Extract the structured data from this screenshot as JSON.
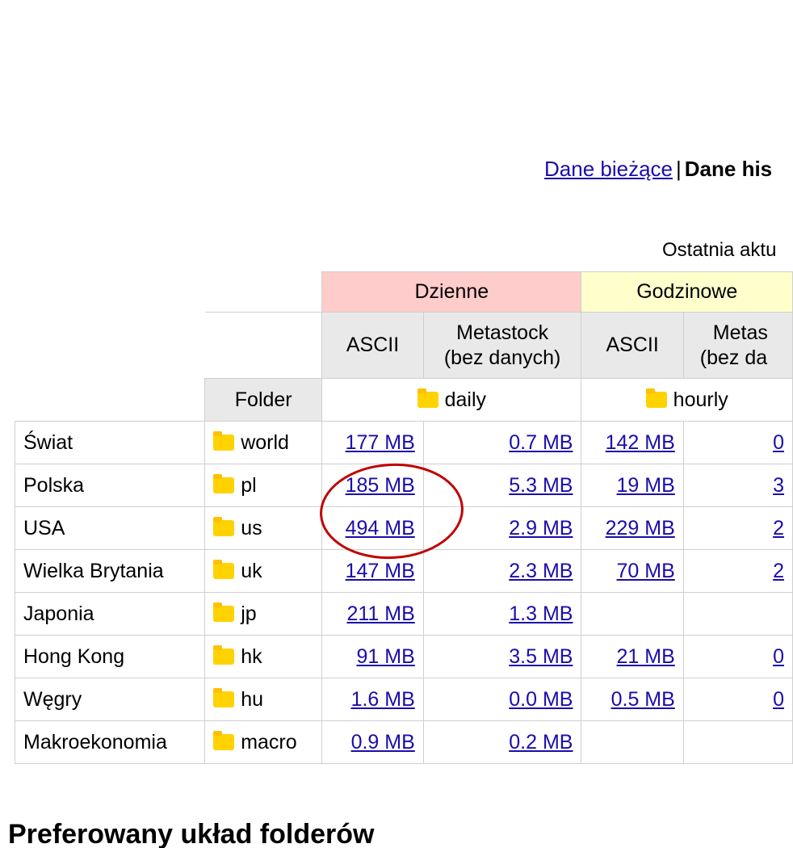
{
  "nav": {
    "current_link": "Dane bieżące",
    "separator": "|",
    "historical_label": "Dane his"
  },
  "updated_label": "Ostatnia aktu",
  "table": {
    "groups": [
      {
        "label": "Dzienne",
        "color": "#ffcccc"
      },
      {
        "label": "Godzinowe",
        "color": "#ffffcc"
      }
    ],
    "subheaders": {
      "ascii": "ASCII",
      "metastock_line1": "Metastock",
      "metastock_line2": "(bez danych)",
      "ascii2": "ASCII",
      "metastock2_line1": "Metas",
      "metastock2_line2": "(bez da"
    },
    "folder_header": "Folder",
    "folder_daily": "daily",
    "folder_hourly": "hourly",
    "rows": [
      {
        "name": "Świat",
        "folder": "world",
        "d_ascii": "177 MB",
        "d_meta": "0.7 MB",
        "h_ascii": "142 MB",
        "h_meta": "0"
      },
      {
        "name": "Polska",
        "folder": "pl",
        "d_ascii": "185 MB",
        "d_meta": "5.3 MB",
        "h_ascii": "19 MB",
        "h_meta": "3"
      },
      {
        "name": "USA",
        "folder": "us",
        "d_ascii": "494 MB",
        "d_meta": "2.9 MB",
        "h_ascii": "229 MB",
        "h_meta": "2"
      },
      {
        "name": "Wielka Brytania",
        "folder": "uk",
        "d_ascii": "147 MB",
        "d_meta": "2.3 MB",
        "h_ascii": "70 MB",
        "h_meta": "2"
      },
      {
        "name": "Japonia",
        "folder": "jp",
        "d_ascii": "211 MB",
        "d_meta": "1.3 MB",
        "h_ascii": "",
        "h_meta": ""
      },
      {
        "name": "Hong Kong",
        "folder": "hk",
        "d_ascii": "91 MB",
        "d_meta": "3.5 MB",
        "h_ascii": "21 MB",
        "h_meta": "0"
      },
      {
        "name": "Węgry",
        "folder": "hu",
        "d_ascii": "1.6 MB",
        "d_meta": "0.0 MB",
        "h_ascii": "0.5 MB",
        "h_meta": "0"
      },
      {
        "name": "Makroekonomia",
        "folder": "macro",
        "d_ascii": "0.9 MB",
        "d_meta": "0.2 MB",
        "h_ascii": "",
        "h_meta": ""
      }
    ]
  },
  "section_heading": "Preferowany układ folderów",
  "colors": {
    "link": "#1a0dab",
    "annotation_circle": "#c00000",
    "folder_icon": "#ffd200"
  }
}
